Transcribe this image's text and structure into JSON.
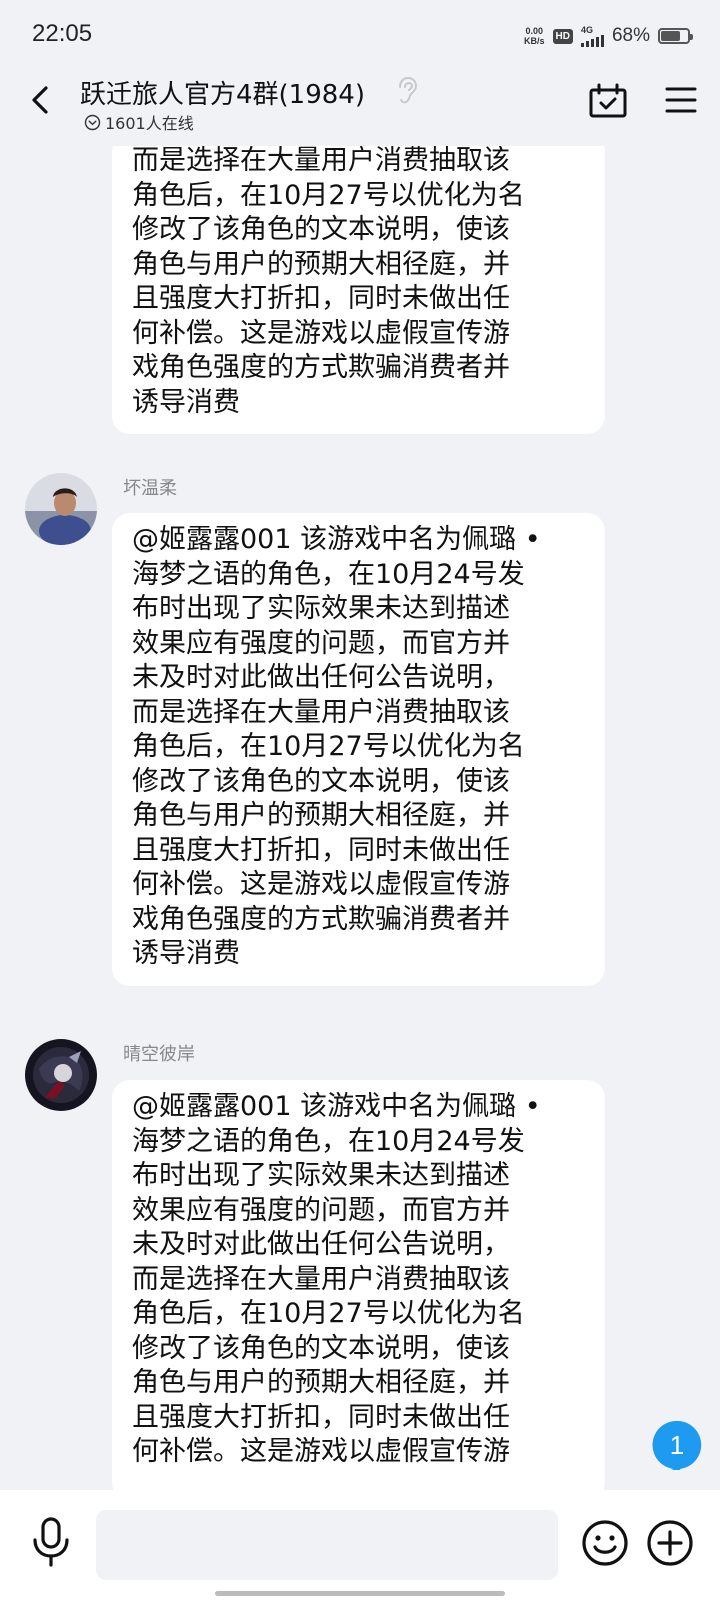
{
  "status_bar": {
    "time": "22:05",
    "net_speed_value": "0.00",
    "net_speed_unit": "KB/s",
    "hd_label": "HD",
    "network_label": "4G",
    "battery_text": "68%",
    "battery_level": 0.68
  },
  "header": {
    "title": "跃迁旅人官方4群(1984)",
    "online_text": "1601人在线"
  },
  "messages": [
    {
      "text": "而是选择在大量用户消费抽取该\n角色后，在10月27号以优化为名\n修改了该角色的文本说明，使该\n角色与用户的预期大相径庭，并\n且强度大打折扣，同时未做出任\n何补偿。这是游戏以虚假宣传游\n戏角色强度的方式欺骗消费者并\n诱导消费"
    },
    {
      "sender": "坏温柔",
      "text": "@姬露露001 该游戏中名为佩璐 •\n海梦之语的角色，在10月24号发\n布时出现了实际效果未达到描述\n效果应有强度的问题，而官方并\n未及时对此做出任何公告说明，\n而是选择在大量用户消费抽取该\n角色后，在10月27号以优化为名\n修改了该角色的文本说明，使该\n角色与用户的预期大相径庭，并\n且强度大打折扣，同时未做出任\n何补偿。这是游戏以虚假宣传游\n戏角色强度的方式欺骗消费者并\n诱导消费"
    },
    {
      "sender": "晴空彼岸",
      "text": "@姬露露001 该游戏中名为佩璐 •\n海梦之语的角色，在10月24号发\n布时出现了实际效果未达到描述\n效果应有强度的问题，而官方并\n未及时对此做出任何公告说明，\n而是选择在大量用户消费抽取该\n角色后，在10月27号以优化为名\n修改了该角色的文本说明，使该\n角色与用户的预期大相径庭，并\n且强度大打折扣，同时未做出任\n何补偿。这是游戏以虚假宣传游"
    }
  ],
  "unread_badge": "1",
  "colors": {
    "background": "#f1f2f6",
    "bubble": "#ffffff",
    "badge": "#1e9bf0",
    "sender_name": "#888888"
  },
  "icons": [
    "back-arrow-icon",
    "ear-icon",
    "online-indicator-icon",
    "calendar-check-icon",
    "menu-icon",
    "microphone-icon",
    "emoji-icon",
    "plus-icon"
  ]
}
